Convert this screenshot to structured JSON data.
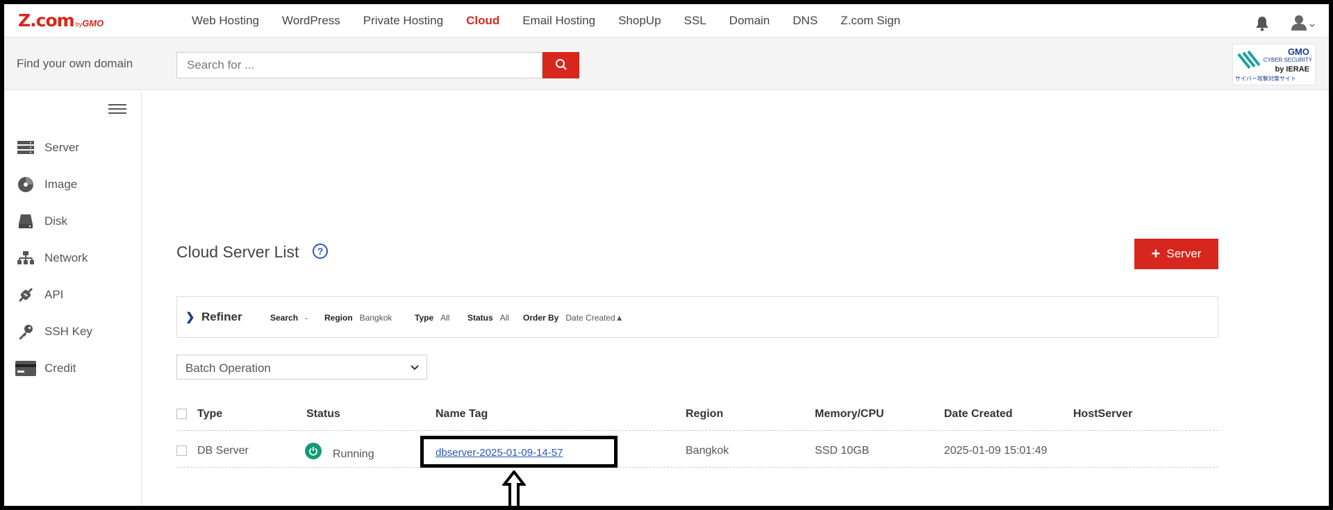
{
  "brand": {
    "main": "Z.com",
    "by": "by",
    "company": "GMO"
  },
  "nav": {
    "items": [
      "Web Hosting",
      "WordPress",
      "Private Hosting",
      "Cloud",
      "Email Hosting",
      "ShopUp",
      "SSL",
      "Domain",
      "DNS",
      "Z.com Sign"
    ],
    "active": "Cloud",
    "icons": [
      "bell-icon",
      "user-icon"
    ]
  },
  "search": {
    "title": "Find your own domain",
    "placeholder": "Search for ...",
    "button_icon": "search-icon"
  },
  "security_badge": {
    "brand": "GMO",
    "line1": "CYBER SECURITY",
    "line2": "by IERAE",
    "line3": "サイバー攻撃対策サイト"
  },
  "sidebar": {
    "items": [
      {
        "label": "Server",
        "icon": "server-icon"
      },
      {
        "label": "Image",
        "icon": "image-icon"
      },
      {
        "label": "Disk",
        "icon": "disk-icon"
      },
      {
        "label": "Network",
        "icon": "network-icon"
      },
      {
        "label": "API",
        "icon": "api-icon"
      },
      {
        "label": "SSH Key",
        "icon": "key-icon"
      },
      {
        "label": "Credit",
        "icon": "credit-card-icon"
      }
    ]
  },
  "main": {
    "title": "Cloud Server List",
    "help_symbol": "?",
    "add_button": {
      "symbol": "+",
      "label": "Server"
    },
    "refiner": {
      "title": "Refiner",
      "filters": [
        {
          "label": "Search",
          "value": "-"
        },
        {
          "label": "Region",
          "value": "Bangkok"
        },
        {
          "label": "Type",
          "value": "All"
        },
        {
          "label": "Status",
          "value": "All"
        },
        {
          "label": "Order By",
          "value": "Date Created▲"
        }
      ]
    },
    "batch_select": "Batch Operation",
    "table": {
      "columns": [
        "Type",
        "Status",
        "Name Tag",
        "Region",
        "Memory/CPU",
        "Date Created",
        "HostServer"
      ],
      "rows": [
        {
          "type": "DB Server",
          "status": "Running",
          "name_tag": "dbserver-2025-01-09-14-57",
          "region": "Bangkok",
          "memory_cpu": "SSD 10GB",
          "date_created": "2025-01-09 15:01:49",
          "host_server": ""
        }
      ]
    }
  },
  "colors": {
    "brand_red": "#d7261d",
    "link_blue": "#2a56b5",
    "running_green": "#139a75"
  }
}
